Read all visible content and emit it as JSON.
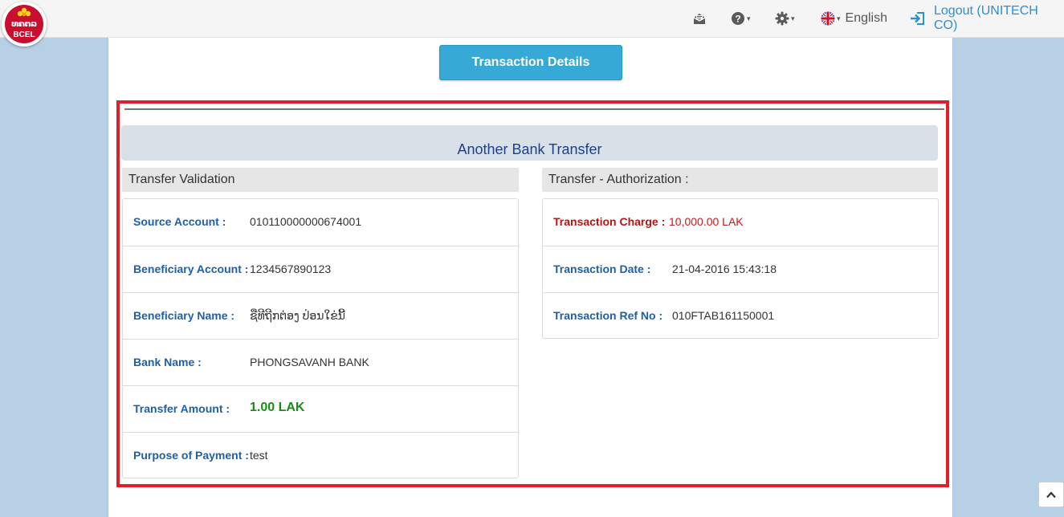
{
  "logo": {
    "brand_script": "ທຄຕລ",
    "brand_text": "BCEL"
  },
  "navbar": {
    "icons": [
      "envelope-open-icon",
      "help-icon",
      "gear-icon"
    ],
    "language": "English",
    "logout_label": "Logout (UNITECH CO)"
  },
  "main": {
    "details_button": "Transaction Details",
    "section_title": "Another Bank Transfer",
    "validation": {
      "header": "Transfer Validation",
      "rows": [
        {
          "label": "Source Account :",
          "value": "010110000000674001"
        },
        {
          "label": "Beneficiary Account :",
          "value": "1234567890123"
        },
        {
          "label": "Beneficiary Name :",
          "value": "ຊືທີຖີກຕ່ອງ ປ່ອນໃຂ່ນີ້"
        },
        {
          "label": "Bank Name :",
          "value": "PHONGSAVANH BANK"
        },
        {
          "label": "Transfer Amount :",
          "value": "1.00 LAK"
        },
        {
          "label": "Purpose of Payment :",
          "value": "test"
        }
      ]
    },
    "authorization": {
      "header": "Transfer - Authorization :",
      "rows": [
        {
          "label": "Transaction Charge :",
          "value": "10,000.00 LAK"
        },
        {
          "label": "Transaction Date :",
          "value": "21-04-2016 15:43:18"
        },
        {
          "label": "Transaction Ref No :",
          "value": "010FTAB161150001"
        }
      ]
    }
  },
  "colors": {
    "accent": "#36a9d7",
    "highlight_border": "#e01f26",
    "label_blue": "#1f5fa8",
    "charge_red": "#c41a1a",
    "amount_green": "#188c16"
  }
}
